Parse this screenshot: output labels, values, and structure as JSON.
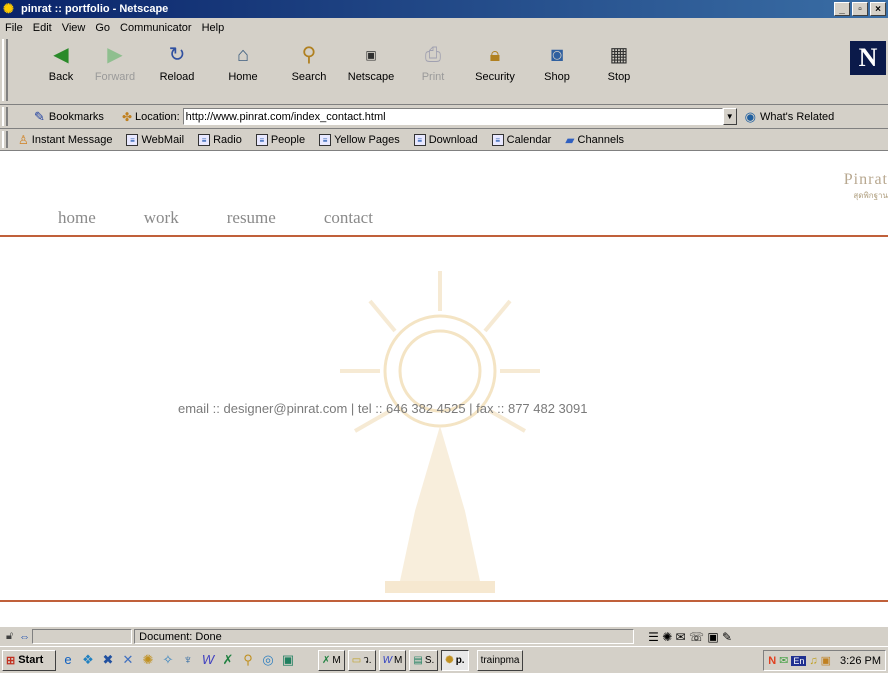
{
  "window": {
    "title": "pinrat :: portfolio - Netscape",
    "controls": [
      "_",
      "▫",
      "×"
    ]
  },
  "menu": [
    "File",
    "Edit",
    "View",
    "Go",
    "Communicator",
    "Help"
  ],
  "toolbar": [
    {
      "label": "Back",
      "icon": "back-arrow-icon",
      "enabled": true
    },
    {
      "label": "Forward",
      "icon": "forward-arrow-icon",
      "enabled": false
    },
    {
      "label": "Reload",
      "icon": "reload-icon",
      "enabled": true
    },
    {
      "label": "Home",
      "icon": "home-icon",
      "enabled": true
    },
    {
      "label": "Search",
      "icon": "search-icon",
      "enabled": true
    },
    {
      "label": "Netscape",
      "icon": "my-netscape-icon",
      "enabled": true
    },
    {
      "label": "Print",
      "icon": "print-icon",
      "enabled": false
    },
    {
      "label": "Security",
      "icon": "lock-icon",
      "enabled": true
    },
    {
      "label": "Shop",
      "icon": "shop-icon",
      "enabled": true
    },
    {
      "label": "Stop",
      "icon": "stop-icon",
      "enabled": true
    }
  ],
  "location": {
    "bookmarks_label": "Bookmarks",
    "location_label": "Location:",
    "url": "http://www.pinrat.com/index_contact.html",
    "related_label": "What's Related"
  },
  "personal_toolbar": [
    "Instant Message",
    "WebMail",
    "Radio",
    "People",
    "Yellow Pages",
    "Download",
    "Calendar",
    "Channels"
  ],
  "page": {
    "nav": [
      "home",
      "work",
      "resume",
      "contact"
    ],
    "brand_top": "Pinrat",
    "brand_sub": "สุดพิกฐาน",
    "contact_line": "email :: designer@pinrat.com   |   tel :: 646 382 4525   |   fax :: 877 482 3091",
    "accent_color": "#c0603a"
  },
  "status": {
    "text": "Document: Done"
  },
  "taskbar": {
    "start_label": "Start",
    "tasks": [
      "M",
      "ว.",
      "M",
      "S.",
      "p.",
      "trainpma"
    ],
    "lang": "En",
    "clock": "3:26 PM"
  }
}
